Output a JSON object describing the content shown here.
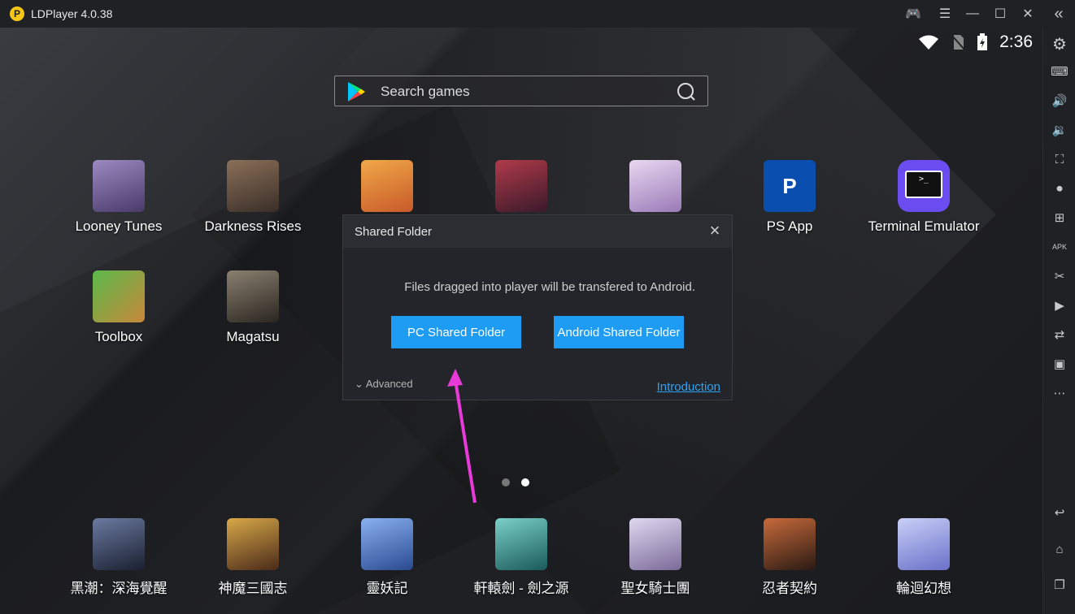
{
  "window": {
    "title": "LDPlayer 4.0.38",
    "logo_glyph": "P",
    "controls": [
      {
        "name": "gamepad-icon",
        "glyph": "🎮"
      },
      {
        "name": "menu-icon",
        "glyph": "☰"
      },
      {
        "name": "minimize-icon",
        "glyph": "—"
      },
      {
        "name": "maximize-icon",
        "glyph": "☐"
      },
      {
        "name": "close-icon",
        "glyph": "✕"
      },
      {
        "name": "collapse-sidebar-icon",
        "glyph": "«"
      }
    ]
  },
  "status_bar": {
    "time": "2:36",
    "wifi_glyph": "▼",
    "sim_glyph": "▰",
    "battery_glyph": "▮"
  },
  "search": {
    "placeholder": "Search games"
  },
  "home_apps_row1": [
    {
      "label": "Looney Tunes",
      "color": "#6b5a8e"
    },
    {
      "label": "Darkness Rises",
      "color": "#5a4a3a"
    },
    {
      "label": "",
      "color": "#e8892b"
    },
    {
      "label": "",
      "color": "#7a2e3a"
    },
    {
      "label": "",
      "color": "#b8a8d8"
    },
    {
      "label": "PS App",
      "color": "#0a4fb0"
    },
    {
      "label": "Terminal Emulator",
      "color": "#6a4cf0"
    }
  ],
  "home_apps_row2": [
    {
      "label": "Toolbox",
      "color": "#4a8a3a"
    },
    {
      "label": "Magatsu",
      "color": "#5a5448"
    }
  ],
  "dock_apps": [
    {
      "label": "黑潮：深海覺醒",
      "color": "#3a4a6a"
    },
    {
      "label": "神魔三國志",
      "color": "#7a5a2a"
    },
    {
      "label": "靈妖記",
      "color": "#4a6ab0"
    },
    {
      "label": "軒轅劍 - 劍之源",
      "color": "#3a8a8a"
    },
    {
      "label": "聖女騎士團",
      "color": "#9a8ab0"
    },
    {
      "label": "忍者契約",
      "color": "#6a3a2a"
    },
    {
      "label": "輪迴幻想",
      "color": "#8a9ae0"
    }
  ],
  "dialog": {
    "title": "Shared Folder",
    "close_glyph": "×",
    "message": "Files dragged into player will be transfered to Android.",
    "pc_button": "PC Shared Folder",
    "android_button": "Android Shared Folder",
    "advanced_label": "Advanced",
    "advanced_chevron": "⌄",
    "intro_link": "Introduction"
  },
  "sidebar": [
    {
      "name": "settings-icon",
      "glyph": "⚙"
    },
    {
      "name": "keyboard-icon",
      "glyph": "⌨"
    },
    {
      "name": "volume-up-icon",
      "glyph": "🔊"
    },
    {
      "name": "volume-down-icon",
      "glyph": "🔉"
    },
    {
      "name": "screenshot-icon",
      "glyph": "⛶"
    },
    {
      "name": "record-icon",
      "glyph": "⏺"
    },
    {
      "name": "add-instance-icon",
      "glyph": "⊞"
    },
    {
      "name": "apk-icon",
      "glyph": "APK"
    },
    {
      "name": "scissors-icon",
      "glyph": "✂"
    },
    {
      "name": "video-icon",
      "glyph": "▶"
    },
    {
      "name": "sync-icon",
      "glyph": "⇄"
    },
    {
      "name": "shake-icon",
      "glyph": "▣"
    },
    {
      "name": "more-icon",
      "glyph": "⋯"
    },
    {
      "name": "back-icon",
      "glyph": "↩"
    },
    {
      "name": "home-icon",
      "glyph": "⌂"
    },
    {
      "name": "recent-apps-icon",
      "glyph": "❐"
    }
  ],
  "colors": {
    "accent": "#1e9cf3",
    "link": "#2ea3f2",
    "arrow": "#e83ad8"
  }
}
